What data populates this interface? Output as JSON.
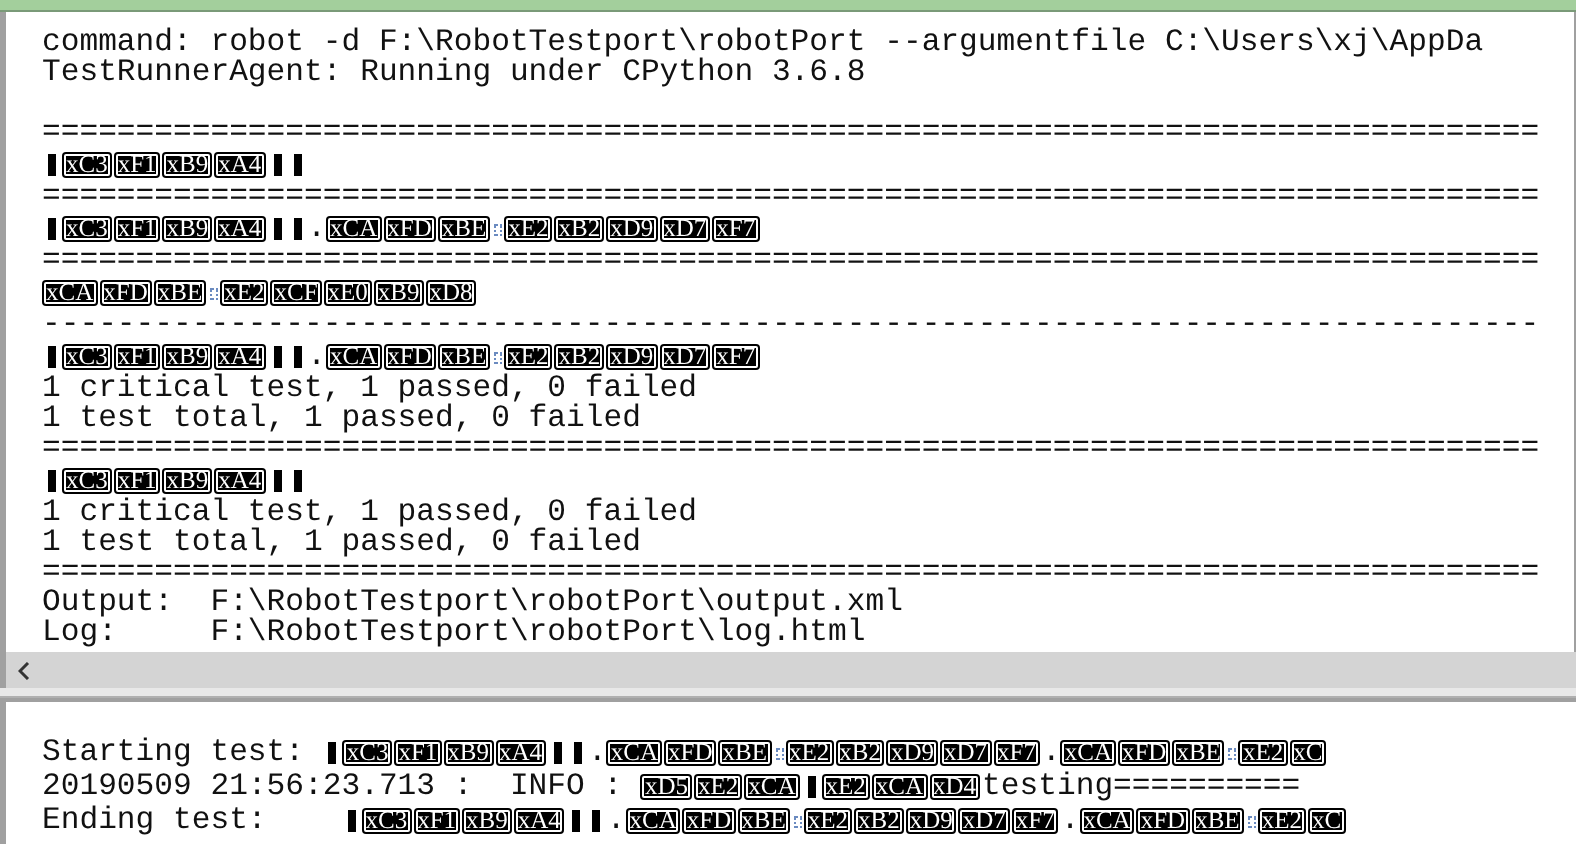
{
  "output_panel": {
    "lines": [
      {
        "kind": "line",
        "segments": [
          {
            "kind": "text",
            "text": "command: robot -d F:\\RobotTestport\\robotPort --argumentfile C:\\Users\\xj\\AppDa"
          }
        ]
      },
      {
        "kind": "line",
        "segments": [
          {
            "kind": "text",
            "text": "TestRunnerAgent: Running under CPython 3.6.8"
          }
        ]
      },
      {
        "kind": "blank"
      },
      {
        "kind": "line",
        "segments": [
          {
            "kind": "text",
            "text": "================================================================================"
          }
        ]
      },
      {
        "kind": "line",
        "segments": [
          {
            "kind": "bar"
          },
          {
            "kind": "byte",
            "text": "xC3"
          },
          {
            "kind": "byte",
            "text": "xF1"
          },
          {
            "kind": "byte",
            "text": "xB9"
          },
          {
            "kind": "byte",
            "text": "xA4"
          },
          {
            "kind": "bar"
          },
          {
            "kind": "bar"
          }
        ]
      },
      {
        "kind": "line",
        "segments": [
          {
            "kind": "text",
            "text": "================================================================================"
          }
        ]
      },
      {
        "kind": "line",
        "segments": [
          {
            "kind": "bar"
          },
          {
            "kind": "byte",
            "text": "xC3"
          },
          {
            "kind": "byte",
            "text": "xF1"
          },
          {
            "kind": "byte",
            "text": "xB9"
          },
          {
            "kind": "byte",
            "text": "xA4"
          },
          {
            "kind": "bar"
          },
          {
            "kind": "bar"
          },
          {
            "kind": "text",
            "text": "."
          },
          {
            "kind": "byte",
            "text": "xCA"
          },
          {
            "kind": "byte",
            "text": "xFD"
          },
          {
            "kind": "byte",
            "text": "xBE"
          },
          {
            "kind": "glyph"
          },
          {
            "kind": "byte",
            "text": "xE2"
          },
          {
            "kind": "byte",
            "text": "xB2"
          },
          {
            "kind": "byte",
            "text": "xD9"
          },
          {
            "kind": "byte",
            "text": "xD7"
          },
          {
            "kind": "byte",
            "text": "xF7"
          }
        ]
      },
      {
        "kind": "line",
        "segments": [
          {
            "kind": "text",
            "text": "================================================================================"
          }
        ]
      },
      {
        "kind": "line",
        "segments": [
          {
            "kind": "byte",
            "text": "xCA"
          },
          {
            "kind": "byte",
            "text": "xFD"
          },
          {
            "kind": "byte",
            "text": "xBE"
          },
          {
            "kind": "glyph"
          },
          {
            "kind": "byte",
            "text": "xE2"
          },
          {
            "kind": "byte",
            "text": "xCF"
          },
          {
            "kind": "byte",
            "text": "xE0"
          },
          {
            "kind": "byte",
            "text": "xB9"
          },
          {
            "kind": "byte",
            "text": "xD8"
          }
        ]
      },
      {
        "kind": "line",
        "segments": [
          {
            "kind": "text",
            "text": "--------------------------------------------------------------------------------"
          }
        ]
      },
      {
        "kind": "line",
        "segments": [
          {
            "kind": "bar"
          },
          {
            "kind": "byte",
            "text": "xC3"
          },
          {
            "kind": "byte",
            "text": "xF1"
          },
          {
            "kind": "byte",
            "text": "xB9"
          },
          {
            "kind": "byte",
            "text": "xA4"
          },
          {
            "kind": "bar"
          },
          {
            "kind": "bar"
          },
          {
            "kind": "text",
            "text": "."
          },
          {
            "kind": "byte",
            "text": "xCA"
          },
          {
            "kind": "byte",
            "text": "xFD"
          },
          {
            "kind": "byte",
            "text": "xBE"
          },
          {
            "kind": "glyph"
          },
          {
            "kind": "byte",
            "text": "xE2"
          },
          {
            "kind": "byte",
            "text": "xB2"
          },
          {
            "kind": "byte",
            "text": "xD9"
          },
          {
            "kind": "byte",
            "text": "xD7"
          },
          {
            "kind": "byte",
            "text": "xF7"
          }
        ]
      },
      {
        "kind": "line",
        "segments": [
          {
            "kind": "text",
            "text": "1 critical test, 1 passed, 0 failed"
          }
        ]
      },
      {
        "kind": "line",
        "segments": [
          {
            "kind": "text",
            "text": "1 test total, 1 passed, 0 failed"
          }
        ]
      },
      {
        "kind": "line",
        "segments": [
          {
            "kind": "text",
            "text": "================================================================================"
          }
        ]
      },
      {
        "kind": "line",
        "segments": [
          {
            "kind": "bar"
          },
          {
            "kind": "byte",
            "text": "xC3"
          },
          {
            "kind": "byte",
            "text": "xF1"
          },
          {
            "kind": "byte",
            "text": "xB9"
          },
          {
            "kind": "byte",
            "text": "xA4"
          },
          {
            "kind": "bar"
          },
          {
            "kind": "bar"
          }
        ]
      },
      {
        "kind": "line",
        "segments": [
          {
            "kind": "text",
            "text": "1 critical test, 1 passed, 0 failed"
          }
        ]
      },
      {
        "kind": "line",
        "segments": [
          {
            "kind": "text",
            "text": "1 test total, 1 passed, 0 failed"
          }
        ]
      },
      {
        "kind": "line",
        "segments": [
          {
            "kind": "text",
            "text": "================================================================================"
          }
        ]
      },
      {
        "kind": "line",
        "segments": [
          {
            "kind": "text",
            "text": "Output:  F:\\RobotTestport\\robotPort\\output.xml"
          }
        ]
      },
      {
        "kind": "line",
        "segments": [
          {
            "kind": "text",
            "text": "Log:     F:\\RobotTestport\\robotPort\\log.html"
          }
        ]
      }
    ]
  },
  "log_panel": {
    "lines": [
      {
        "kind": "blank"
      },
      {
        "kind": "line",
        "segments": [
          {
            "kind": "text",
            "text": "Starting test: "
          },
          {
            "kind": "bar"
          },
          {
            "kind": "byte",
            "text": "xC3"
          },
          {
            "kind": "byte",
            "text": "xF1"
          },
          {
            "kind": "byte",
            "text": "xB9"
          },
          {
            "kind": "byte",
            "text": "xA4"
          },
          {
            "kind": "bar"
          },
          {
            "kind": "bar"
          },
          {
            "kind": "text",
            "text": "."
          },
          {
            "kind": "byte",
            "text": "xCA"
          },
          {
            "kind": "byte",
            "text": "xFD"
          },
          {
            "kind": "byte",
            "text": "xBE"
          },
          {
            "kind": "glyph"
          },
          {
            "kind": "byte",
            "text": "xE2"
          },
          {
            "kind": "byte",
            "text": "xB2"
          },
          {
            "kind": "byte",
            "text": "xD9"
          },
          {
            "kind": "byte",
            "text": "xD7"
          },
          {
            "kind": "byte",
            "text": "xF7"
          },
          {
            "kind": "text",
            "text": "."
          },
          {
            "kind": "byte",
            "text": "xCA"
          },
          {
            "kind": "byte",
            "text": "xFD"
          },
          {
            "kind": "byte",
            "text": "xBE"
          },
          {
            "kind": "glyph"
          },
          {
            "kind": "byte",
            "text": "xE2"
          },
          {
            "kind": "byte",
            "text": "xC"
          }
        ]
      },
      {
        "kind": "line",
        "segments": [
          {
            "kind": "text",
            "text": "20190509 21:56:23.713 :  INFO : "
          },
          {
            "kind": "byte",
            "text": "xD5"
          },
          {
            "kind": "byte",
            "text": "xE2"
          },
          {
            "kind": "byte",
            "text": "xCA"
          },
          {
            "kind": "bar"
          },
          {
            "kind": "byte",
            "text": "xE2"
          },
          {
            "kind": "byte",
            "text": "xCA"
          },
          {
            "kind": "byte",
            "text": "xD4"
          },
          {
            "kind": "text",
            "text": "testing=========="
          }
        ]
      },
      {
        "kind": "line",
        "segments": [
          {
            "kind": "text",
            "text": "Ending test:    "
          },
          {
            "kind": "bar"
          },
          {
            "kind": "byte",
            "text": "xC3"
          },
          {
            "kind": "byte",
            "text": "xF1"
          },
          {
            "kind": "byte",
            "text": "xB9"
          },
          {
            "kind": "byte",
            "text": "xA4"
          },
          {
            "kind": "bar"
          },
          {
            "kind": "bar"
          },
          {
            "kind": "text",
            "text": "."
          },
          {
            "kind": "byte",
            "text": "xCA"
          },
          {
            "kind": "byte",
            "text": "xFD"
          },
          {
            "kind": "byte",
            "text": "xBE"
          },
          {
            "kind": "glyph"
          },
          {
            "kind": "byte",
            "text": "xE2"
          },
          {
            "kind": "byte",
            "text": "xB2"
          },
          {
            "kind": "byte",
            "text": "xD9"
          },
          {
            "kind": "byte",
            "text": "xD7"
          },
          {
            "kind": "byte",
            "text": "xF7"
          },
          {
            "kind": "text",
            "text": "."
          },
          {
            "kind": "byte",
            "text": "xCA"
          },
          {
            "kind": "byte",
            "text": "xFD"
          },
          {
            "kind": "byte",
            "text": "xBE"
          },
          {
            "kind": "glyph"
          },
          {
            "kind": "byte",
            "text": "xE2"
          },
          {
            "kind": "byte",
            "text": "xC"
          }
        ]
      }
    ]
  }
}
